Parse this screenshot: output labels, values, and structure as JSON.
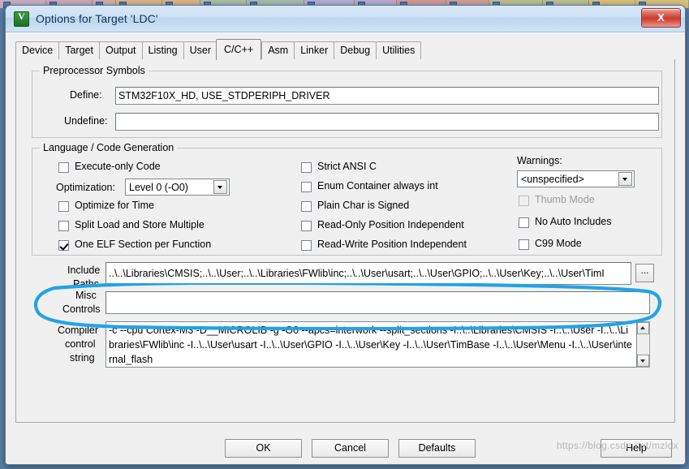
{
  "window": {
    "title": "Options for Target 'LDC'",
    "icon": "keil-uvision-icon",
    "close_label": "X"
  },
  "tabs": [
    {
      "label": "Device",
      "active": false
    },
    {
      "label": "Target",
      "active": false
    },
    {
      "label": "Output",
      "active": false
    },
    {
      "label": "Listing",
      "active": false
    },
    {
      "label": "User",
      "active": false
    },
    {
      "label": "C/C++",
      "active": true
    },
    {
      "label": "Asm",
      "active": false
    },
    {
      "label": "Linker",
      "active": false
    },
    {
      "label": "Debug",
      "active": false
    },
    {
      "label": "Utilities",
      "active": false
    }
  ],
  "preprocessor": {
    "legend": "Preprocessor Symbols",
    "define_label": "Define:",
    "define_value": "STM32F10X_HD, USE_STDPERIPH_DRIVER",
    "undefine_label": "Undefine:",
    "undefine_value": ""
  },
  "language": {
    "legend": "Language / Code Generation",
    "left_checks": [
      {
        "label": "Execute-only Code",
        "checked": false,
        "disabled": false
      },
      {
        "label": "Optimize for Time",
        "checked": false,
        "disabled": false
      },
      {
        "label": "Split Load and Store Multiple",
        "checked": false,
        "disabled": false
      },
      {
        "label": "One ELF Section per Function",
        "checked": true,
        "disabled": false
      }
    ],
    "optimization_label": "Optimization:",
    "optimization_value": "Level 0 (-O0)",
    "middle_checks": [
      {
        "label": "Strict ANSI C",
        "checked": false,
        "disabled": false
      },
      {
        "label": "Enum Container always int",
        "checked": false,
        "disabled": false
      },
      {
        "label": "Plain Char is Signed",
        "checked": false,
        "disabled": false
      },
      {
        "label": "Read-Only Position Independent",
        "checked": false,
        "disabled": false
      },
      {
        "label": "Read-Write Position Independent",
        "checked": false,
        "disabled": false
      }
    ],
    "warnings_label": "Warnings:",
    "warnings_value": "<unspecified>",
    "right_checks": [
      {
        "label": "Thumb Mode",
        "checked": false,
        "disabled": true
      },
      {
        "label": "No Auto Includes",
        "checked": false,
        "disabled": false
      },
      {
        "label": "C99 Mode",
        "checked": false,
        "disabled": false
      }
    ]
  },
  "paths": {
    "include_label_line1": "Include",
    "include_label_line2": "Paths",
    "include_value": "..\\..\\Libraries\\CMSIS;..\\..\\User;..\\..\\Libraries\\FWlib\\inc;..\\..\\User\\usart;..\\..\\User\\GPIO;..\\..\\User\\Key;..\\..\\User\\TimI",
    "browse_label": "...",
    "misc_label_line1": "Misc",
    "misc_label_line2": "Controls",
    "misc_value": ""
  },
  "compiler": {
    "label_line1": "Compiler",
    "label_line2": "control",
    "label_line3": "string",
    "value": "-c --cpu Cortex-M3 -D__MICROLIB -g -O0 --apcs=interwork --split_sections -I..\\..\\Libraries\\CMSIS -I..\\..\\User -I..\\..\\Libraries\\FWlib\\inc -I..\\..\\User\\usart -I..\\..\\User\\GPIO -I..\\..\\User\\Key -I..\\..\\User\\TimBase -I..\\..\\User\\Menu -I..\\..\\User\\internal_flash"
  },
  "buttons": {
    "ok": "OK",
    "cancel": "Cancel",
    "defaults": "Defaults",
    "help": "Help"
  },
  "watermark": "https://blog.csdn.net/mzldx",
  "colors": {
    "annotation": "#21a3e8",
    "title_text": "#16335c",
    "close_red": "#c93b2d"
  }
}
